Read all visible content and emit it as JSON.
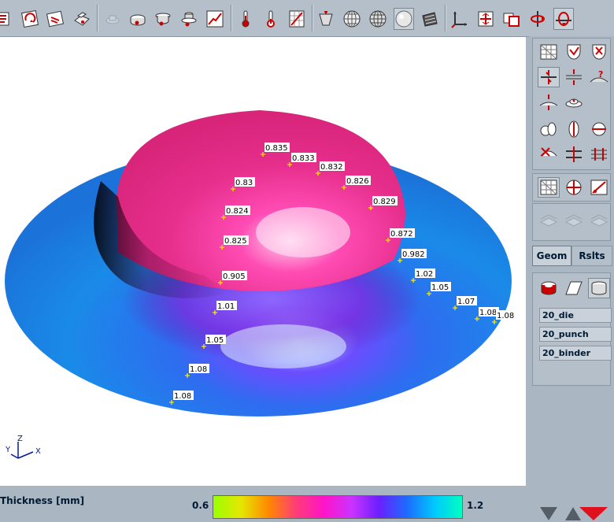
{
  "toolbar": {
    "icons": [
      "stack-icon",
      "rotate-icon",
      "doc-icon",
      "printer-icon",
      "disabled-tool-icon",
      "die-icon",
      "punch-icon",
      "binder-icon",
      "curve-icon",
      "thermometer-icon",
      "thermometer-alt-icon",
      "grid-icon",
      "lamp-icon",
      "globe-icon",
      "globe-alt-icon",
      "sphere-icon",
      "shading-icon",
      "axis-icon",
      "fit-icon",
      "pan-icon",
      "rotate-axis-icon",
      "rotate-active-icon"
    ]
  },
  "viewport": {
    "triad": {
      "z": "Z",
      "y": "Y",
      "x": "X"
    },
    "thickness_labels": [
      "0.835",
      "0.833",
      "0.832",
      "0.826",
      "0.829",
      "0.83",
      "0.824",
      "0.825",
      "0.872",
      "0.982",
      "0.905",
      "1.02",
      "1.05",
      "1.01",
      "1.07",
      "1.08",
      "1.08",
      "1.05",
      "1.08",
      "1.08"
    ]
  },
  "rightpanel": {
    "tabs": {
      "geom": "Geom",
      "rslts": "Rslts"
    },
    "objects": [
      "20_die",
      "20_punch",
      "20_binder"
    ]
  },
  "legend": {
    "title": "Thickness [mm]",
    "min": "0.6",
    "max": "1.2",
    "gradient": [
      "#9aff00",
      "#e6e600",
      "#ff8800",
      "#ff3c7a",
      "#ff14c8",
      "#cc33ff",
      "#6a20ff",
      "#1e6bff",
      "#00c8ff",
      "#00ffc0"
    ]
  }
}
